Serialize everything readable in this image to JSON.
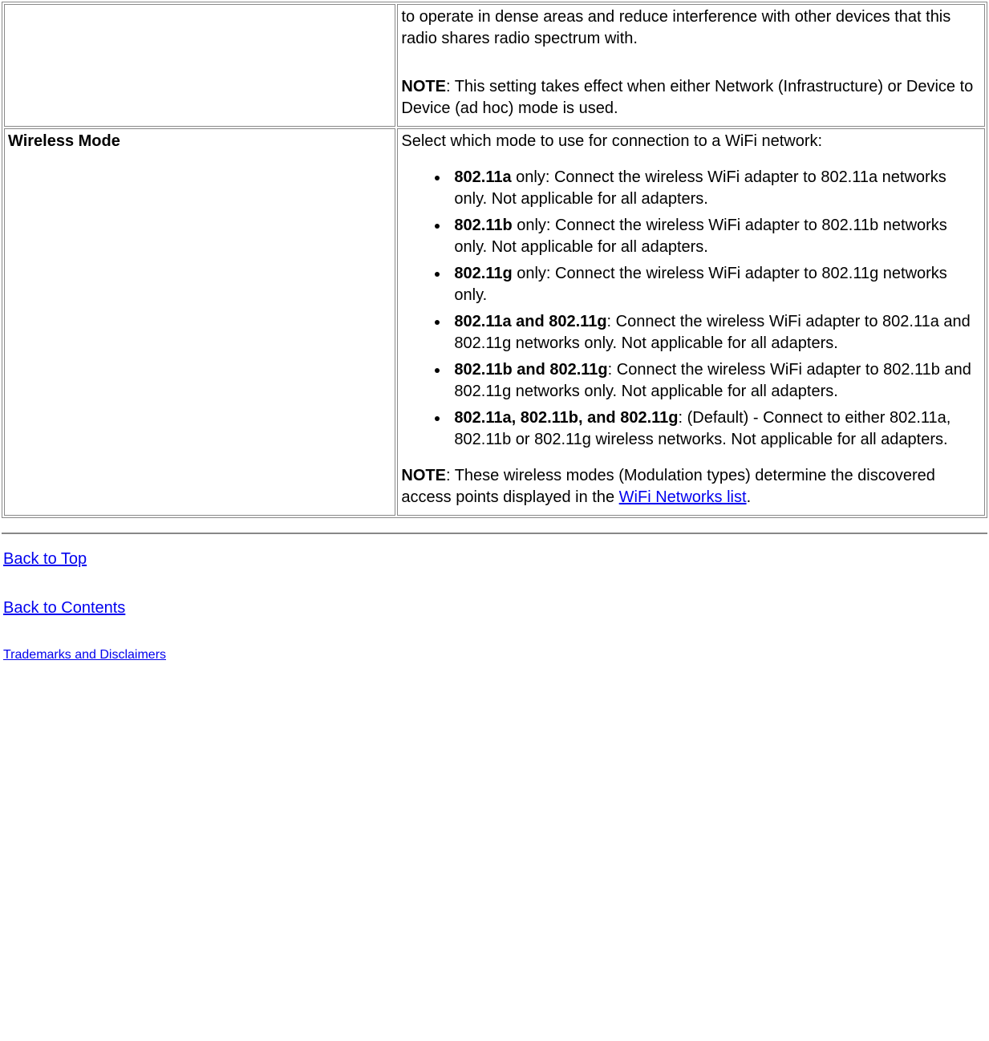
{
  "table": {
    "rows": [
      {
        "name": "",
        "desc": {
          "para1": "to operate in dense areas and reduce interference with other devices that this radio shares radio spectrum with.",
          "note_label": "NOTE",
          "note_text": ": This setting takes effect when either Network (Infrastructure) or Device to Device (ad hoc) mode is used."
        }
      },
      {
        "name": "Wireless Mode",
        "desc": {
          "intro": "Select which mode to use for connection to a WiFi network:",
          "modes": [
            {
              "bold": "802.11a",
              "rest": " only: Connect the wireless WiFi adapter to 802.11a networks only. Not applicable for all adapters."
            },
            {
              "bold": "802.11b",
              "rest": " only: Connect the wireless WiFi adapter to 802.11b networks only. Not applicable for all adapters."
            },
            {
              "bold": "802.11g",
              "rest": " only: Connect the wireless WiFi adapter to 802.11g networks only."
            },
            {
              "bold": "802.11a and 802.11g",
              "rest": ": Connect the wireless WiFi adapter to 802.11a and 802.11g networks only. Not applicable for all adapters."
            },
            {
              "bold": "802.11b and 802.11g",
              "rest": ": Connect the wireless WiFi adapter to 802.11b and 802.11g networks only. Not applicable for all adapters."
            },
            {
              "bold": "802.11a, 802.11b, and 802.11g",
              "rest": ": (Default) - Connect to either 802.11a, 802.11b or 802.11g wireless networks. Not applicable for all adapters."
            }
          ],
          "note_label": "NOTE",
          "note_pre": ": These wireless modes (Modulation types) determine the discovered access points displayed in the ",
          "note_link": "WiFi Networks list",
          "note_post": "."
        }
      }
    ]
  },
  "links": {
    "back_to_top": "Back to Top",
    "back_to_contents": "Back to Contents",
    "trademarks": "Trademarks and Disclaimers"
  }
}
